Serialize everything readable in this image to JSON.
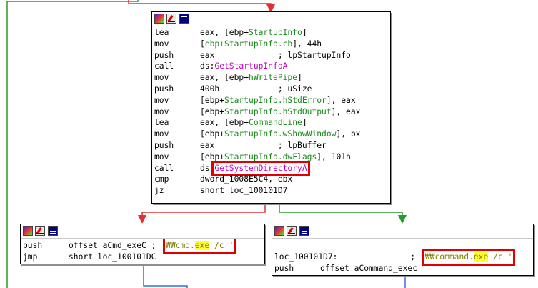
{
  "main_block": {
    "lines": [
      {
        "mnemonic": "lea",
        "parts": [
          {
            "t": "eax, [ebp+"
          },
          {
            "t": "StartupInfo",
            "c": "sym"
          },
          {
            "t": "]"
          }
        ]
      },
      {
        "mnemonic": "mov",
        "parts": [
          {
            "t": "["
          },
          {
            "t": "ebp+StartupInfo.cb",
            "c": "sym"
          },
          {
            "t": "], 44h"
          }
        ]
      },
      {
        "mnemonic": "push",
        "parts": [
          {
            "t": "eax"
          },
          {
            "t": "             ; lpStartupInfo",
            "c": "cm"
          }
        ]
      },
      {
        "mnemonic": "call",
        "parts": [
          {
            "t": "ds:"
          },
          {
            "t": "GetStartupInfoA",
            "c": "fn"
          }
        ]
      },
      {
        "mnemonic": "mov",
        "parts": [
          {
            "t": "eax, [ebp+"
          },
          {
            "t": "hWritePipe",
            "c": "sym"
          },
          {
            "t": "]"
          }
        ]
      },
      {
        "mnemonic": "push",
        "parts": [
          {
            "t": "400h"
          },
          {
            "t": "            ; uSize",
            "c": "cm"
          }
        ]
      },
      {
        "mnemonic": "mov",
        "parts": [
          {
            "t": "[ebp+"
          },
          {
            "t": "StartupInfo.hStdError",
            "c": "sym"
          },
          {
            "t": "], eax"
          }
        ]
      },
      {
        "mnemonic": "mov",
        "parts": [
          {
            "t": "[ebp+"
          },
          {
            "t": "StartupInfo.hStdOutput",
            "c": "sym"
          },
          {
            "t": "], eax"
          }
        ]
      },
      {
        "mnemonic": "lea",
        "parts": [
          {
            "t": "eax, [ebp+"
          },
          {
            "t": "CommandLine",
            "c": "sym"
          },
          {
            "t": "]"
          }
        ]
      },
      {
        "mnemonic": "mov",
        "parts": [
          {
            "t": "[ebp+"
          },
          {
            "t": "StartupInfo.wShowWindow",
            "c": "sym"
          },
          {
            "t": "], bx"
          }
        ]
      },
      {
        "mnemonic": "push",
        "parts": [
          {
            "t": "eax"
          },
          {
            "t": "             ; lpBuffer",
            "c": "cm"
          }
        ]
      },
      {
        "mnemonic": "mov",
        "parts": [
          {
            "t": "[ebp+"
          },
          {
            "t": "StartupInfo.dwFlags",
            "c": "sym"
          },
          {
            "t": "], 101h"
          }
        ]
      },
      {
        "mnemonic": "call",
        "parts": [
          {
            "t": "ds:"
          },
          {
            "t": "GetSystemDirectoryA",
            "c": "fn",
            "box": true
          }
        ]
      },
      {
        "mnemonic": "cmp",
        "parts": [
          {
            "t": "dword_1008E5C4, ebx"
          }
        ]
      },
      {
        "mnemonic": "jz",
        "parts": [
          {
            "t": "short loc_100101D7"
          }
        ]
      }
    ]
  },
  "left_block": {
    "lines": [
      {
        "mnemonic": "push",
        "parts": [
          {
            "t": "offset aCmd_exeC ; "
          },
          {
            "t": "'",
            "c": "str"
          },
          {
            "t": "₩₩cmd.",
            "c": "str",
            "box": "s"
          },
          {
            "t": "exe",
            "c": "str hl",
            "box": "m"
          },
          {
            "t": " /c '",
            "c": "str",
            "box": "e"
          }
        ]
      },
      {
        "mnemonic": "jmp",
        "parts": [
          {
            "t": "short loc_100101DC"
          }
        ]
      }
    ]
  },
  "right_block": {
    "lines": [
      {
        "mnemonic": "",
        "parts": [
          {
            "t": ""
          }
        ]
      },
      {
        "mnemonic": "",
        "parts": [
          {
            "t": "loc_100101D7:               ; "
          },
          {
            "t": "\"",
            "c": "str"
          },
          {
            "t": "₩₩command.",
            "c": "str",
            "box": "s"
          },
          {
            "t": "exe",
            "c": "str hl",
            "box": "m"
          },
          {
            "t": " /c '",
            "c": "str",
            "box": "e"
          }
        ]
      },
      {
        "mnemonic": "push",
        "parts": [
          {
            "t": "offset aCommand_exec"
          }
        ]
      }
    ]
  },
  "colors": {
    "true_edge": "#2a9a2a",
    "false_edge": "#e03030",
    "flow_edge": "#3a6adf",
    "symbol": "#1a8a1a",
    "function": "#c000c0",
    "string": "#808000",
    "highlight": "#ffff33",
    "annotation_box": "#e00000"
  },
  "toolbar_icons": [
    "graph-color-icon",
    "edit-node-icon",
    "node-list-icon"
  ]
}
